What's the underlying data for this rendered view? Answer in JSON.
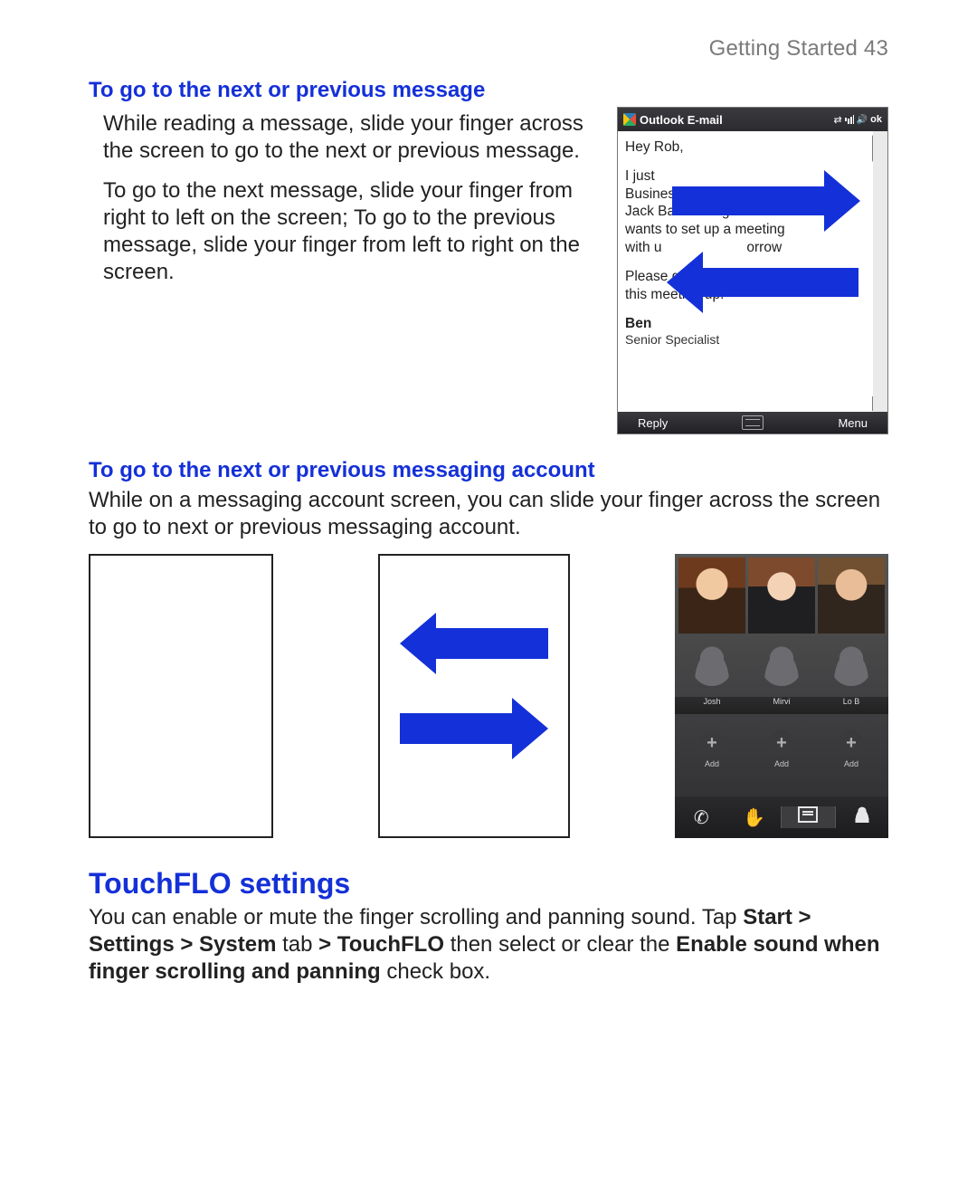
{
  "page": {
    "running_head": "Getting Started  43"
  },
  "sec1": {
    "heading": "To go to the next or previous message",
    "p1": "While reading a message, slide your finger across the screen to go to the next or previous message.",
    "p2": "To go to the next message, slide your finger from right to left on the screen; To go to the previous message, slide your finger from left to right on the screen."
  },
  "email": {
    "app_title": "Outlook E-mail",
    "ok": "ok",
    "greeting": "Hey Rob,",
    "line_ijust": "I just",
    "line_bu": "Business Unlimited's",
    "line_bu_tail": "O",
    "line3": "Jack Bass telling me that he",
    "line4": "wants to set up a meeting",
    "line5a": "with u",
    "line5b": "orrow",
    "p3": "Please get back to me so we can set this meeting up.",
    "sig_name": "Ben",
    "sig_title": "Senior Specialist",
    "reply": "Reply",
    "menu": "Menu"
  },
  "sec2": {
    "heading": "To go to the next or previous messaging account",
    "p1": "While on a messaging account screen, you can slide your finger across the screen to go to next or previous messaging account."
  },
  "contacts": {
    "label1": "Josh",
    "label2": "Mirvi",
    "label3": "Lo B",
    "add": "Add"
  },
  "sec3": {
    "heading": "TouchFLO settings",
    "p_pre": "You can enable or mute the finger scrolling and panning sound. Tap ",
    "b1": "Start > Settings > System",
    "mid1": " tab ",
    "b2": "> TouchFLO",
    "mid2": " then select or clear the ",
    "b3": "Enable sound when finger scrolling and panning",
    "tail": " check box."
  }
}
